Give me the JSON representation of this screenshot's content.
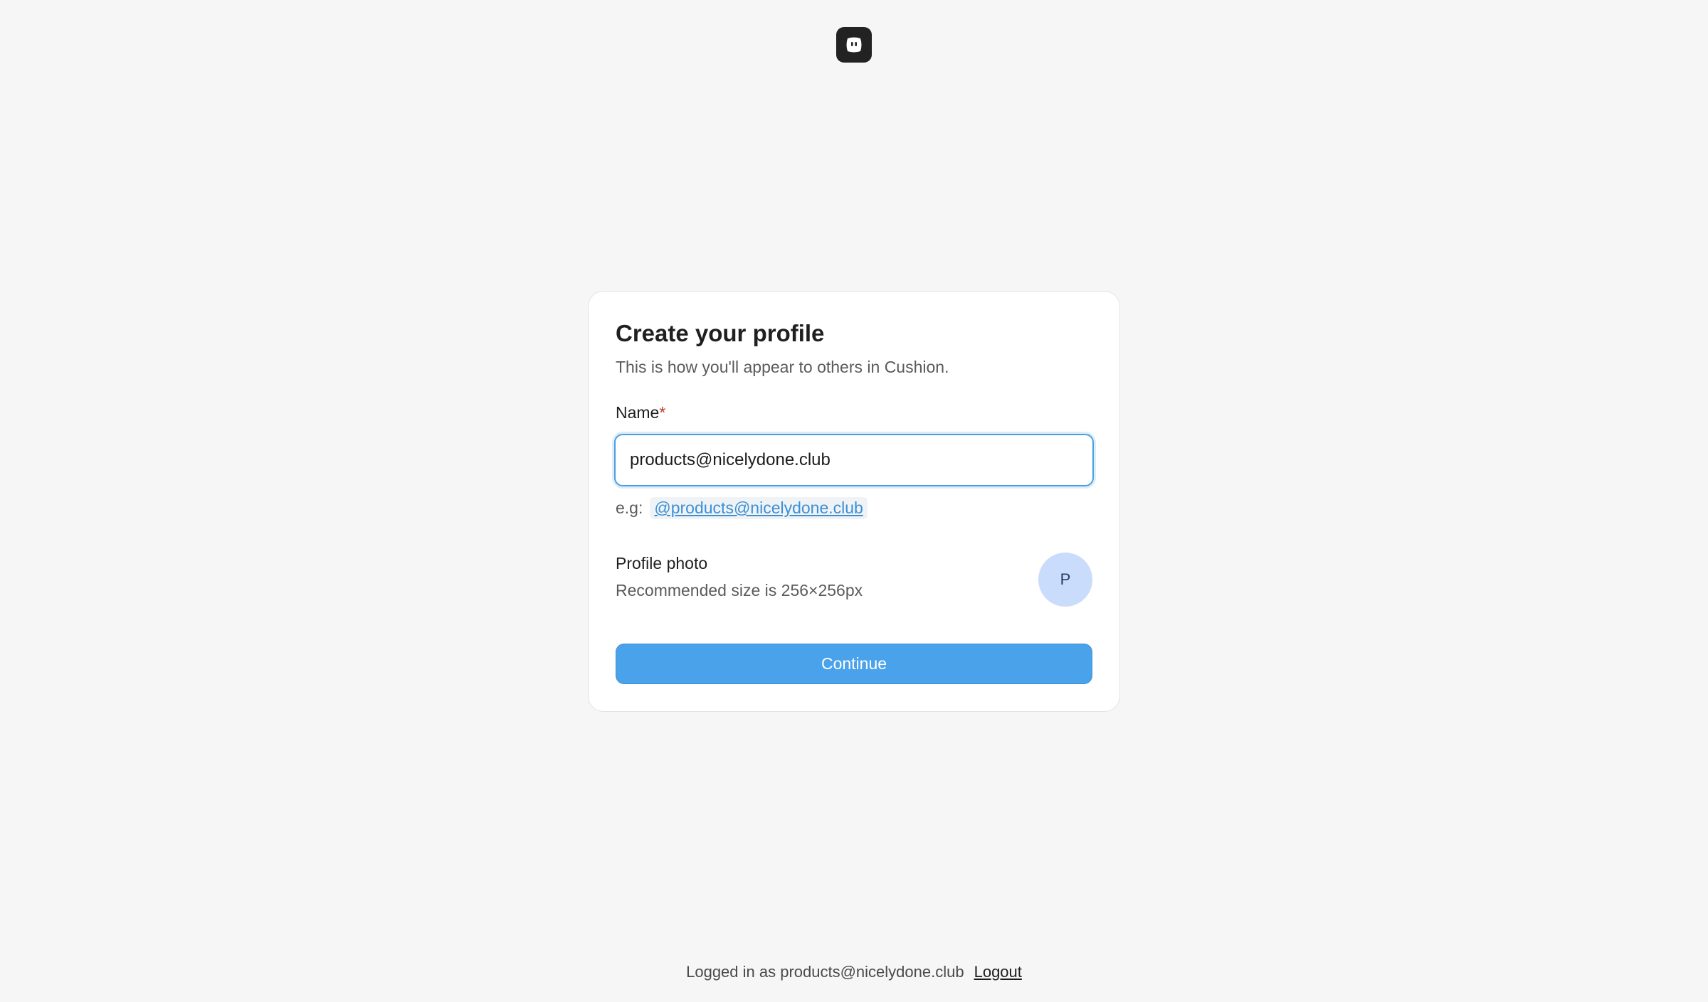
{
  "app": {
    "logo_icon": "cushion-logo-icon",
    "brand_name": "Cushion"
  },
  "form": {
    "title": "Create your profile",
    "subtitle": "This is how you'll appear to others in Cushion.",
    "name_label": "Name",
    "required_mark": "*",
    "name_value": "products@nicelydone.club",
    "example_prefix": "e.g:",
    "example_handle": "@products@nicelydone.club",
    "photo_label": "Profile photo",
    "photo_hint": "Recommended size is 256×256px",
    "avatar_initial": "P",
    "continue_label": "Continue"
  },
  "footer": {
    "logged_in_text": "Logged in as products@nicelydone.club",
    "logout_label": "Logout"
  },
  "colors": {
    "accent": "#4aa3ea",
    "focus_ring": "#4a9fe0",
    "avatar_bg": "#c9dcfb",
    "required": "#c0392b",
    "background": "#f6f6f6"
  }
}
